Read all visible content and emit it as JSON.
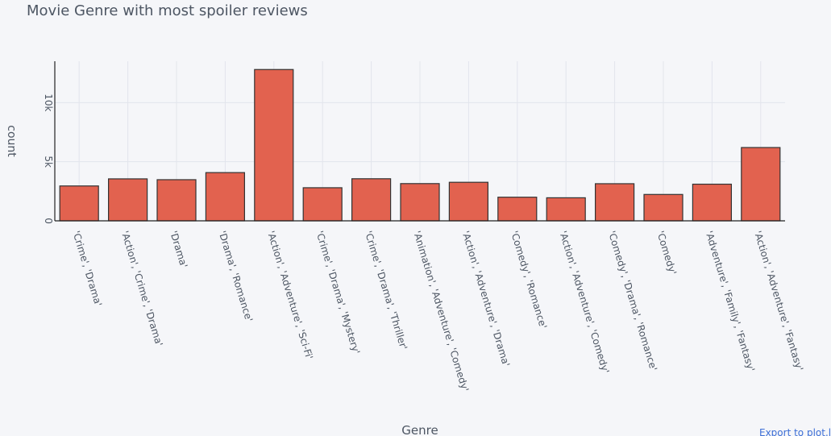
{
  "title": "Movie Genre with most spoiler reviews",
  "export_link": "Export to plot.ly »",
  "colors": {
    "background": "#f5f6f9",
    "bar_fill": "#e2624f",
    "bar_stroke": "#333333",
    "grid": "#e2e5ec",
    "text": "#4d5663",
    "link": "#3d6fd6"
  },
  "chart_data": {
    "type": "bar",
    "title": "Movie Genre with most spoiler reviews",
    "xlabel": "Genre",
    "ylabel": "count",
    "ylim": [
      0,
      13500
    ],
    "yticks": [
      0,
      5000,
      10000
    ],
    "ytick_labels": [
      "0",
      "5k",
      "10k"
    ],
    "grid": true,
    "categories": [
      "'Crime', 'Drama'",
      "'Action', 'Crime', 'Drama'",
      "'Drama'",
      "'Drama', 'Romance'",
      "'Action', 'Adventure', 'Sci-Fi'",
      "'Crime', 'Drama', 'Mystery'",
      "'Crime', 'Drama', 'Thriller'",
      "'Animation', 'Adventure', 'Comedy'",
      "'Action', 'Adventure', 'Drama'",
      "'Comedy', 'Romance'",
      "'Action', 'Adventure', 'Comedy'",
      "'Comedy', 'Drama', 'Romance'",
      "'Comedy'",
      "'Adventure', 'Family', 'Fantasy'",
      "'Action', 'Adventure', 'Fantasy'"
    ],
    "values": [
      2950,
      3550,
      3480,
      4080,
      12800,
      2800,
      3560,
      3150,
      3260,
      2000,
      1950,
      3140,
      2230,
      3100,
      6200
    ]
  }
}
